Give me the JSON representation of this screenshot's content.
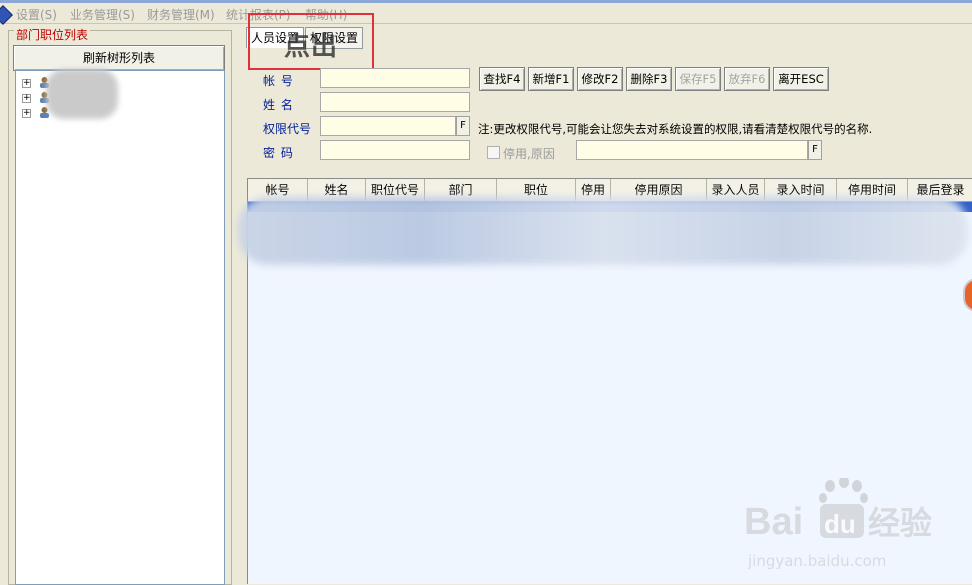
{
  "menu": {
    "items": [
      "设置(S)",
      "业务管理(S)",
      "财务管理(M)",
      "统计报表(P)",
      "帮助(H)"
    ]
  },
  "left_panel": {
    "title": "部门职位列表",
    "refresh_button": "刷新树形列表",
    "tree": {
      "nodes": [
        {
          "label": ""
        },
        {
          "label": ""
        },
        {
          "label": ""
        }
      ]
    }
  },
  "tabs": [
    {
      "label": "人员设置",
      "active": true
    },
    {
      "label": "权限设置",
      "active": false
    }
  ],
  "annotation": {
    "text": "点出",
    "box_color": "#e0303a"
  },
  "form": {
    "fields": [
      {
        "label": "帐    号",
        "value": ""
      },
      {
        "label": "姓    名",
        "value": ""
      },
      {
        "label": "权限代号",
        "value": ""
      },
      {
        "label": "密    码",
        "value": ""
      }
    ],
    "f_button": "F",
    "note": "注:更改权限代号,可能会让您失去对系统设置的权限,请看清楚权限代号的名称.",
    "disable_checkbox_label": "停用,原因",
    "disable_reason": ""
  },
  "toolbar": {
    "buttons": [
      {
        "label": "查找F4",
        "enabled": true
      },
      {
        "label": "新增F1",
        "enabled": true
      },
      {
        "label": "修改F2",
        "enabled": true
      },
      {
        "label": "删除F3",
        "enabled": true
      },
      {
        "label": "保存F5",
        "enabled": false
      },
      {
        "label": "放弃F6",
        "enabled": false
      },
      {
        "label": "离开ESC",
        "enabled": true
      }
    ]
  },
  "grid": {
    "columns": [
      "帐号",
      "姓名",
      "职位代号",
      "部门",
      "职位",
      "停用",
      "停用原因",
      "录入人员",
      "录入时间",
      "停用时间",
      "最后登录"
    ]
  },
  "watermark": {
    "brand": "Bai du 经验",
    "url": "jingyan.baidu.com"
  },
  "colors": {
    "accent_red": "#c00000",
    "label_blue": "#00209a",
    "selected_row": "#3060c8",
    "input_bg": "#fffde6"
  }
}
